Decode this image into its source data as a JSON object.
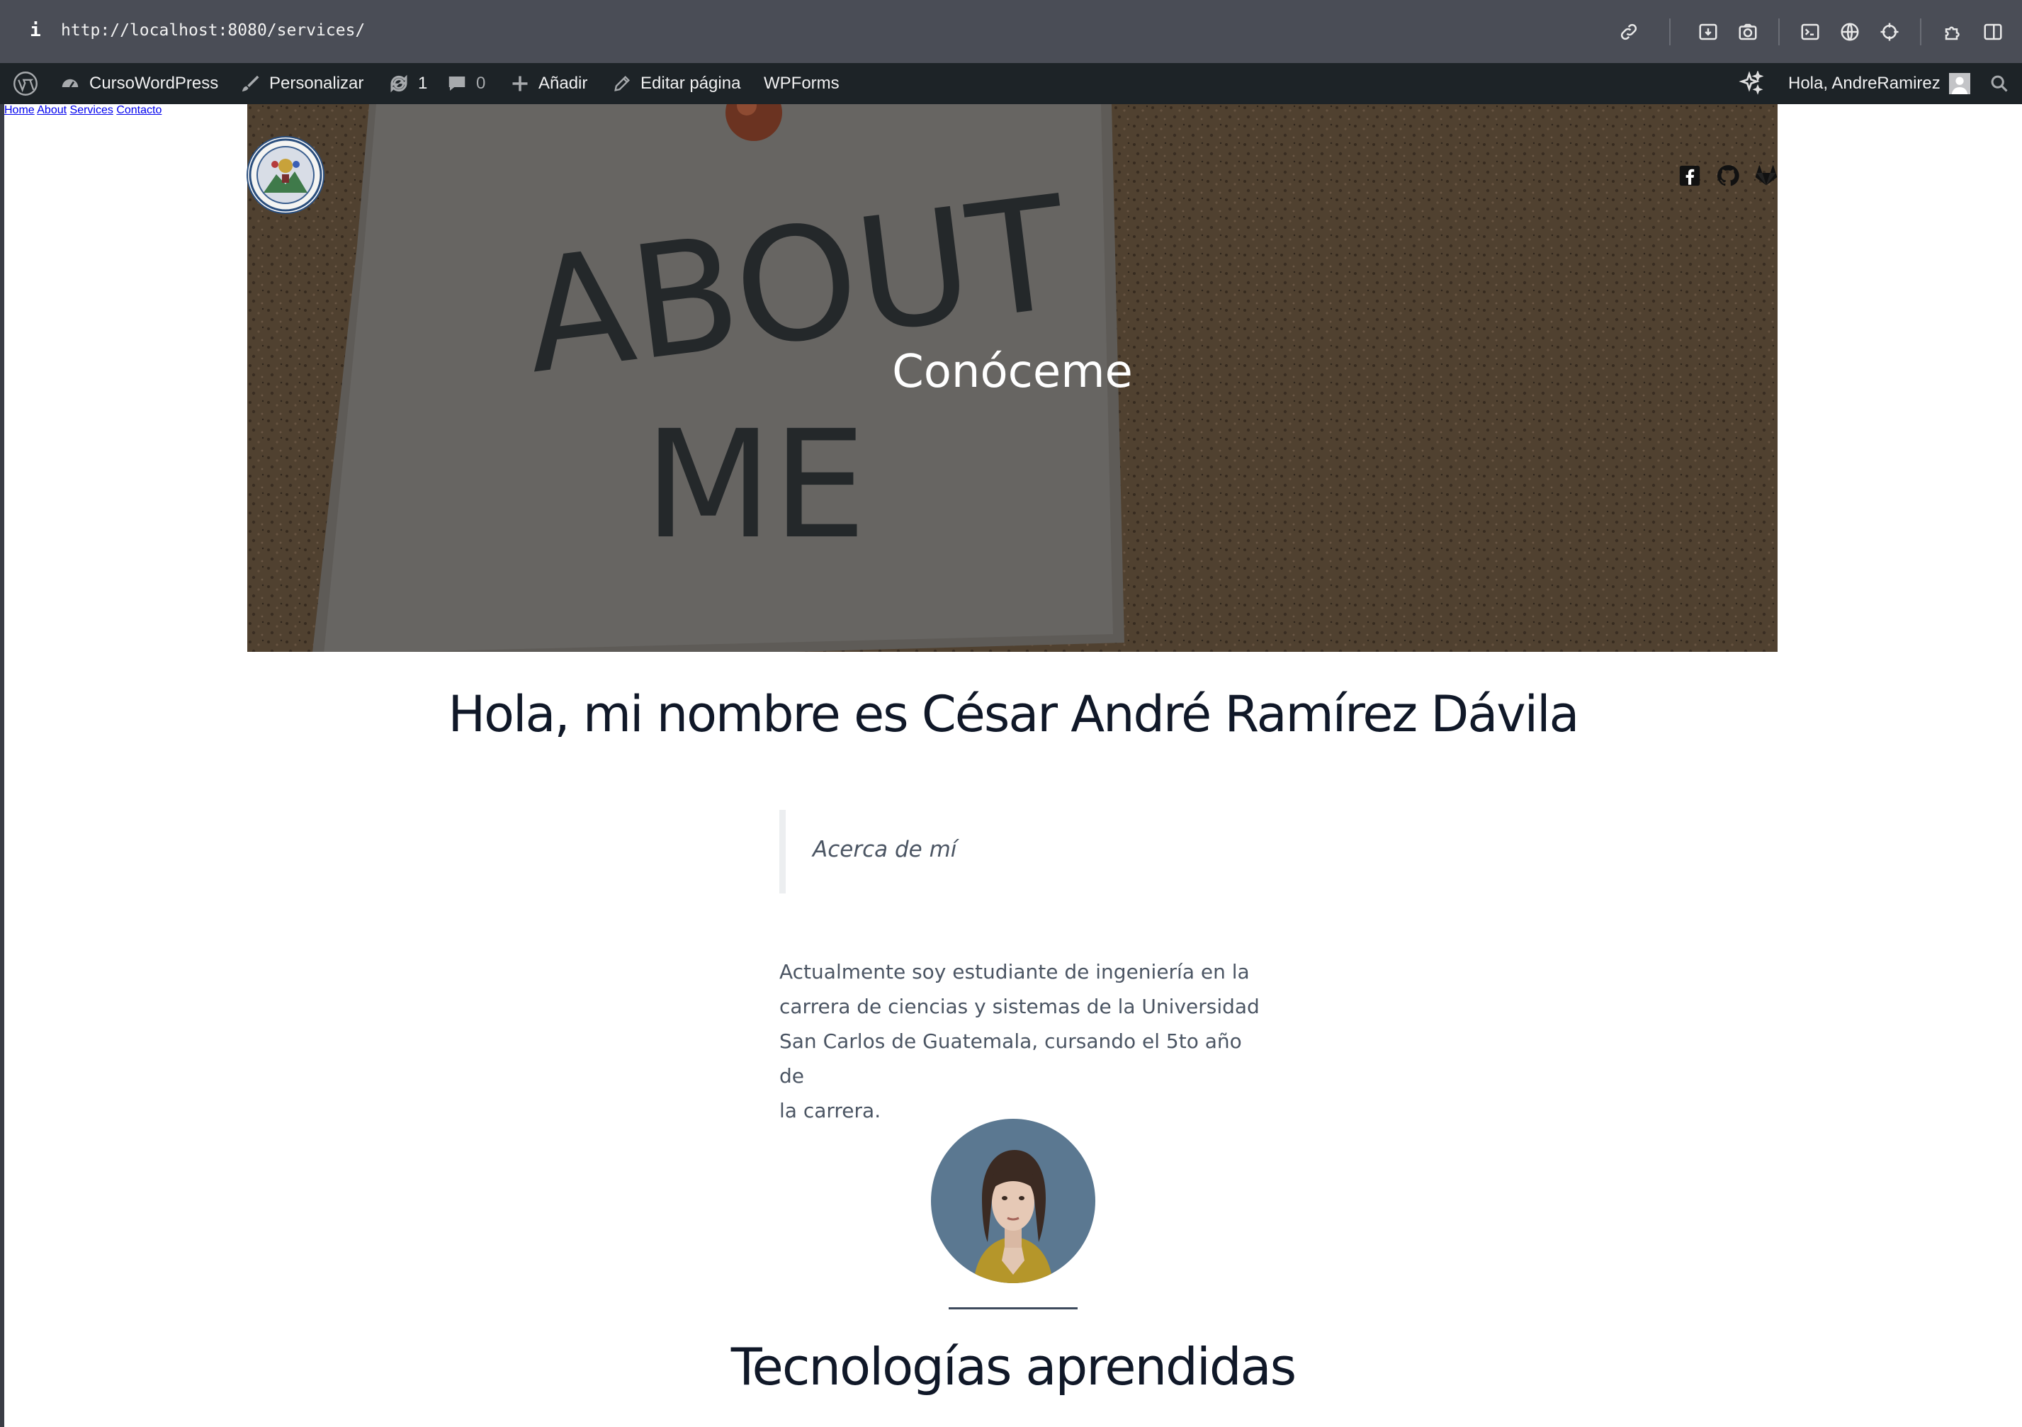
{
  "browser": {
    "url": "http://localhost:8080/services/",
    "info_glyph": "i",
    "toolbar_icons": [
      "link-icon",
      "download-icon",
      "camera-icon",
      "terminal-icon",
      "globe-icon",
      "crosshair-icon",
      "extension-icon",
      "sidebar-icon"
    ]
  },
  "admin_bar": {
    "site_name": "CursoWordPress",
    "customize": "Personalizar",
    "updates_count": "1",
    "comments_count": "0",
    "add_new": "Añadir",
    "edit_page": "Editar página",
    "wpforms": "WPForms",
    "greeting": "Hola, AndreRamirez"
  },
  "header": {
    "nav": [
      "Home",
      "About",
      "Services",
      "Contacto"
    ],
    "social": [
      "facebook-icon",
      "github-icon",
      "gitlab-icon"
    ]
  },
  "hero": {
    "title": "Conóceme",
    "image_text_line1": "ABOUT",
    "image_text_line2": "ME"
  },
  "content": {
    "heading": "Hola, mi nombre es César André Ramírez Dávila",
    "quote": "Acerca de mí",
    "paragraph_lines": [
      "Actualmente soy estudiante de ingeniería en la",
      "carrera de ciencias y sistemas de la Universidad",
      "San Carlos de Guatemala, cursando el 5to año de",
      "la carrera."
    ],
    "section_title": "Tecnologías aprendidas"
  },
  "colors": {
    "admin_bar_bg": "#1d2327",
    "heading": "#101828",
    "body_text": "#4b5563"
  }
}
